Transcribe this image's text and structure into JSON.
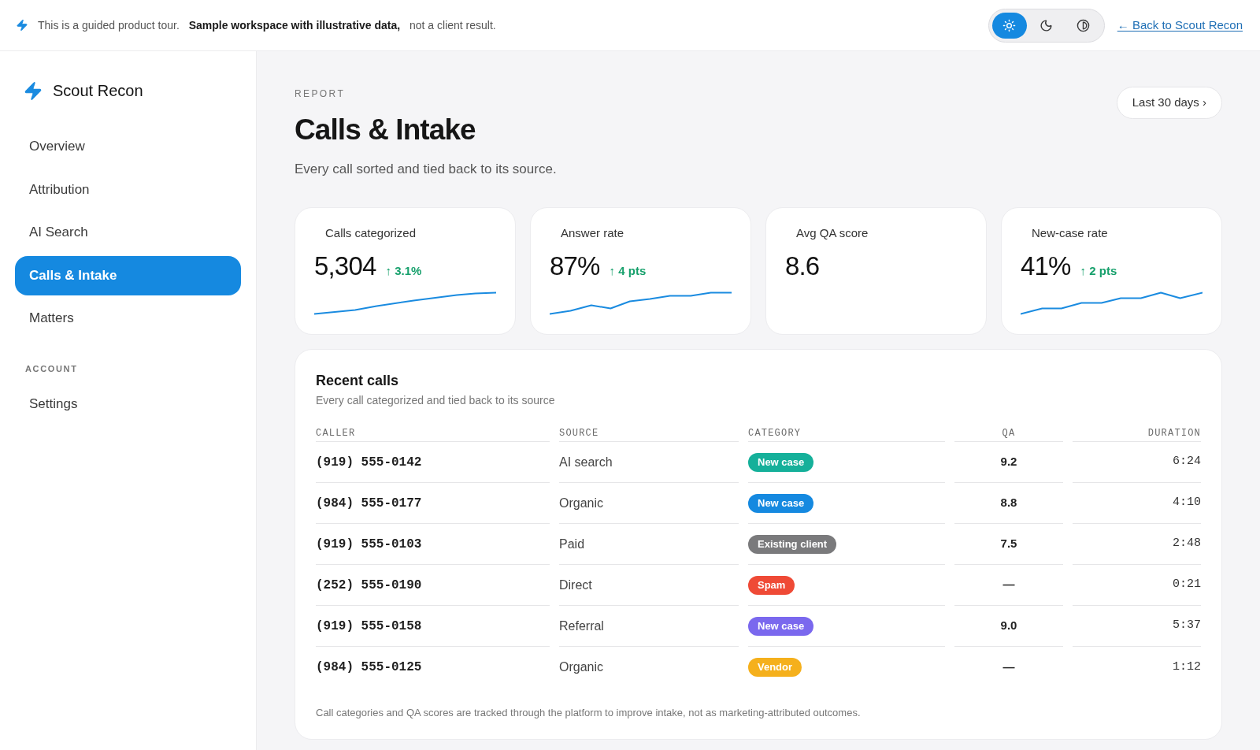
{
  "banner": {
    "text": "This is a guided product tour. **Sample workspace with illustrative data,** not a client result.",
    "theme_options": [
      {
        "kind": "light",
        "selected": true
      },
      {
        "kind": "dark",
        "selected": false
      },
      {
        "kind": "contrast",
        "selected": false
      }
    ],
    "back_link": "← Back to Scout Recon"
  },
  "sidebar": {
    "brand": "Scout Recon",
    "items": [
      {
        "label": "Overview",
        "selected": false
      },
      {
        "label": "Attribution",
        "selected": false
      },
      {
        "label": "AI Search",
        "selected": false
      },
      {
        "label": "Calls & Intake",
        "selected": true
      },
      {
        "label": "Matters",
        "selected": false
      }
    ],
    "sections": [
      {
        "heading": "ACCOUNT",
        "items": [
          {
            "label": "Settings",
            "selected": false
          }
        ]
      }
    ]
  },
  "header": {
    "eyebrow": "REPORT",
    "title": "Calls & Intake",
    "subtitle": "Every call sorted and tied back to its source.",
    "range_button": "Last 30 days ›"
  },
  "metrics": [
    {
      "label": "Calls categorized",
      "value": "5,304",
      "delta": "↑ 3.1%"
    },
    {
      "label": "Answer rate",
      "value": "87%",
      "delta": "↑ 4 pts"
    },
    {
      "label": "Avg QA score",
      "value": "8.6"
    },
    {
      "label": "New-case rate",
      "value": "41%",
      "delta": "↑ 2 pts"
    }
  ],
  "recent_calls": {
    "title": "Recent calls",
    "subtitle": "Every call categorized and tied back to its source",
    "columns": [
      "CALLER",
      "SOURCE",
      "CATEGORY",
      "QA",
      "DURATION"
    ],
    "rows": [
      {
        "caller": "(919) 555-0142",
        "source": "AI search",
        "category": {
          "label": "New case",
          "color": "#15b09a"
        },
        "qa": "9.2",
        "duration": "6:24"
      },
      {
        "caller": "(984) 555-0177",
        "source": "Organic",
        "category": {
          "label": "New case",
          "color": "#1589e0"
        },
        "qa": "8.8",
        "duration": "4:10"
      },
      {
        "caller": "(919) 555-0103",
        "source": "Paid",
        "category": {
          "label": "Existing client",
          "color": "#7a7a7c"
        },
        "qa": "7.5",
        "duration": "2:48"
      },
      {
        "caller": "(252) 555-0190",
        "source": "Direct",
        "category": {
          "label": "Spam",
          "color": "#ef4a36"
        },
        "qa": "—",
        "duration": "0:21"
      },
      {
        "caller": "(919) 555-0158",
        "source": "Referral",
        "category": {
          "label": "New case",
          "color": "#7a68ee"
        },
        "qa": "9.0",
        "duration": "5:37"
      },
      {
        "caller": "(984) 555-0125",
        "source": "Organic",
        "category": {
          "label": "Vendor",
          "color": "#f5b01c"
        },
        "qa": "—",
        "duration": "1:12"
      }
    ],
    "footnote": "Call categories and QA scores are tracked through the platform to improve intake, not as marketing-attributed outcomes."
  }
}
